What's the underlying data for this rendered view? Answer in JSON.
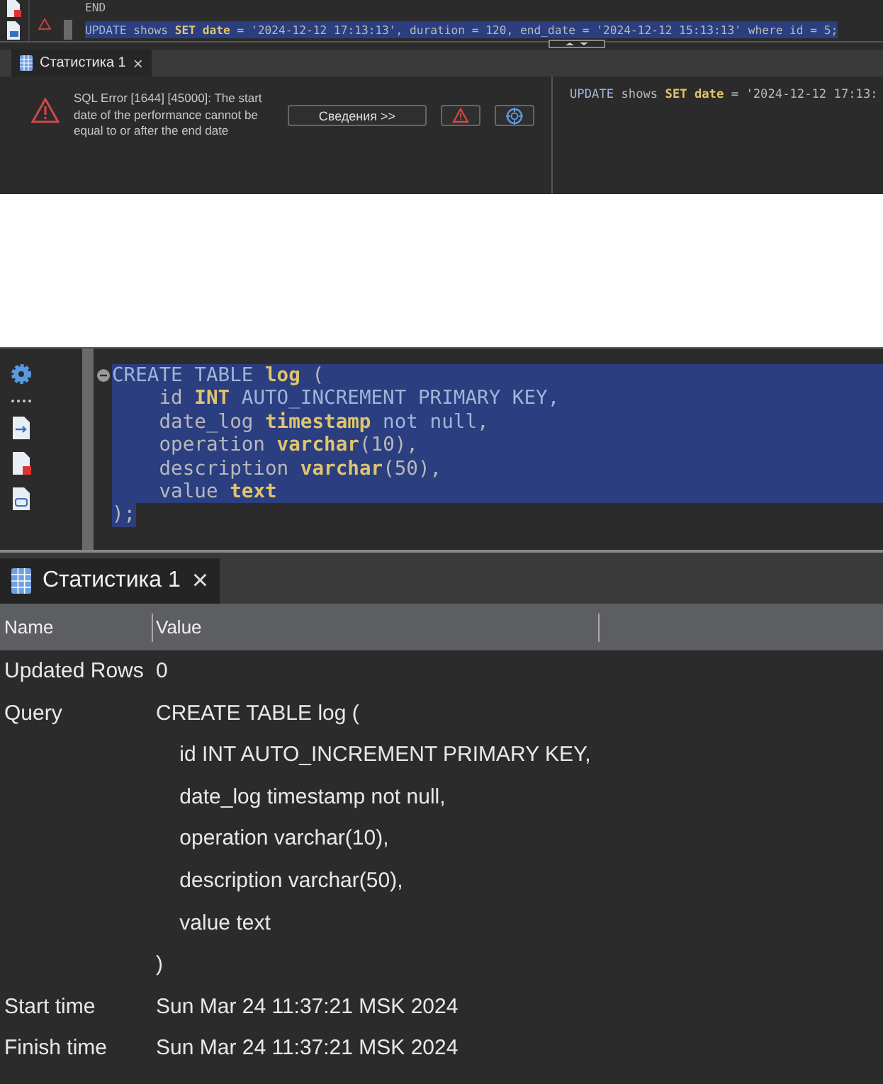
{
  "top_editor": {
    "lines": [
      {
        "selected": false,
        "tokens": [
          {
            "t": "END",
            "kind": "plain"
          }
        ]
      },
      {
        "selected": true,
        "tokens": [
          {
            "t": "UPDATE",
            "kind": "kw"
          },
          {
            "t": " shows ",
            "kind": "plain"
          },
          {
            "t": "SET date",
            "kind": "type"
          },
          {
            "t": " = '2024-12-12 17:13:13', duration = 120, end_date = '2024-12-12 15:13:13' where id = 5;",
            "kind": "plain"
          }
        ]
      }
    ]
  },
  "top_tab": {
    "label": "Статистика 1",
    "close": "×",
    "selected": true
  },
  "error_panel": {
    "message": "SQL Error [1644] [45000]: The start date of the performance cannot be equal to or after the end date",
    "details_button": "Сведения >>",
    "query_tokens": [
      {
        "t": "UPDATE",
        "kind": "kw"
      },
      {
        "t": " shows ",
        "kind": "plain"
      },
      {
        "t": "SET date",
        "kind": "type"
      },
      {
        "t": " = '2024-12-12 17:13:",
        "kind": "plain"
      }
    ]
  },
  "editor": {
    "lines": [
      [
        {
          "t": "CREATE TABLE ",
          "kind": "kw"
        },
        {
          "t": "log",
          "kind": "type"
        },
        {
          "t": " (",
          "kind": "plain"
        }
      ],
      [
        {
          "t": "    id ",
          "kind": "plain"
        },
        {
          "t": "INT",
          "kind": "type"
        },
        {
          "t": " AUTO_INCREMENT PRIMARY KEY,",
          "kind": "kw"
        }
      ],
      [
        {
          "t": "    date_log ",
          "kind": "plain"
        },
        {
          "t": "timestamp",
          "kind": "type"
        },
        {
          "t": " not null",
          "kind": "kw"
        },
        {
          "t": ",",
          "kind": "plain"
        }
      ],
      [
        {
          "t": "    operation ",
          "kind": "plain"
        },
        {
          "t": "varchar",
          "kind": "type"
        },
        {
          "t": "(10),",
          "kind": "plain"
        }
      ],
      [
        {
          "t": "    description ",
          "kind": "plain"
        },
        {
          "t": "varchar",
          "kind": "type"
        },
        {
          "t": "(50),",
          "kind": "plain"
        }
      ],
      [
        {
          "t": "    value ",
          "kind": "plain"
        },
        {
          "t": "text",
          "kind": "type"
        }
      ],
      [
        {
          "t": ");",
          "kind": "plain"
        }
      ]
    ]
  },
  "tab": {
    "label": "Статистика 1",
    "close": "×",
    "selected": true
  },
  "table": {
    "columns": [
      "Name",
      "Value"
    ],
    "rows": [
      {
        "name": "Updated Rows",
        "value": [
          "0"
        ]
      },
      {
        "name": "Query",
        "value": [
          "CREATE TABLE log (",
          "    id INT AUTO_INCREMENT PRIMARY KEY,",
          "    date_log timestamp not null,",
          "    operation varchar(10),",
          "    description varchar(50),",
          "    value text",
          ")"
        ]
      },
      {
        "name": "Start time",
        "value": [
          "Sun Mar 24 11:37:21 MSK 2024"
        ]
      },
      {
        "name": "Finish time",
        "value": [
          "Sun Mar 24 11:37:21 MSK 2024"
        ]
      }
    ]
  }
}
